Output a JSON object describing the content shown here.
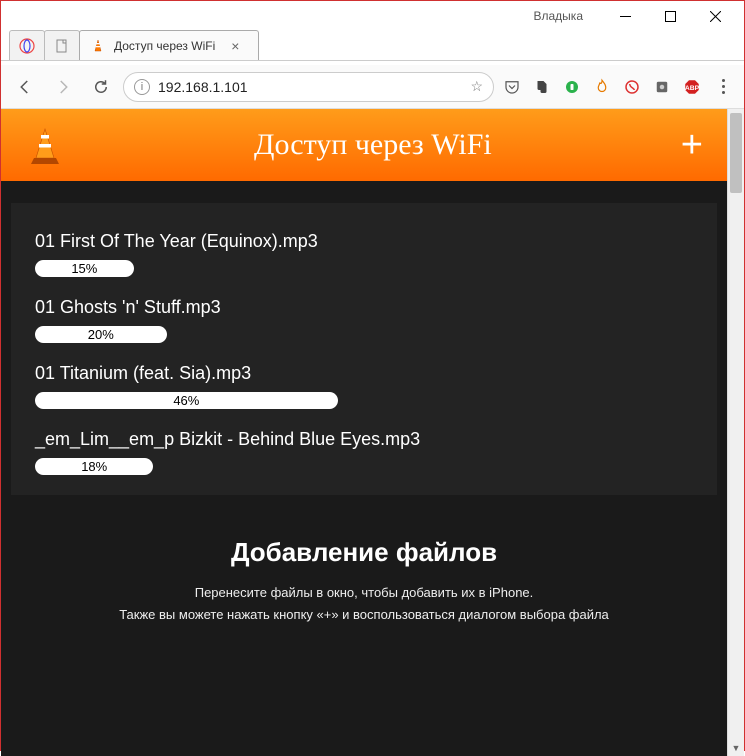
{
  "window": {
    "user_label": "Владыка"
  },
  "browser": {
    "tab_title": "Доступ через WiFi",
    "url": "192.168.1.101"
  },
  "page": {
    "header_title": "Доступ через WiFi",
    "uploads": [
      {
        "name": "01 First Of The Year (Equinox).mp3",
        "percent": 15,
        "label": "15%"
      },
      {
        "name": "01 Ghosts 'n' Stuff.mp3",
        "percent": 20,
        "label": "20%"
      },
      {
        "name": "01 Titanium (feat. Sia).mp3",
        "percent": 46,
        "label": "46%"
      },
      {
        "name": "_em_Lim__em_p Bizkit - Behind Blue Eyes.mp3",
        "percent": 18,
        "label": "18%"
      }
    ],
    "instructions": {
      "heading": "Добавление файлов",
      "line1": "Перенесите файлы в окно, чтобы добавить их в iPhone.",
      "line2": "Также вы можете нажать кнопку «+» и воспользоваться диалогом выбора файла"
    }
  }
}
